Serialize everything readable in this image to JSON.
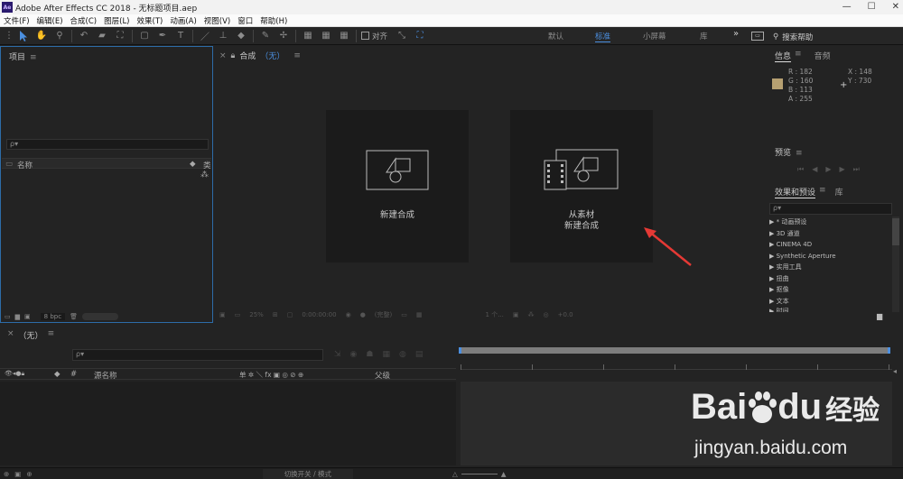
{
  "titlebar": {
    "app_icon": "Ae",
    "title": "Adobe After Effects CC 2018 - 无标题项目.aep",
    "minimize": "—",
    "maximize": "☐",
    "close": "✕"
  },
  "menu": [
    "文件(F)",
    "编辑(E)",
    "合成(C)",
    "图层(L)",
    "效果(T)",
    "动画(A)",
    "视图(V)",
    "窗口",
    "帮助(H)"
  ],
  "toolbar": {
    "align_label": "对齐",
    "expand": "»",
    "search_placeholder": "搜索帮助"
  },
  "workspaces": [
    "默认",
    "标准",
    "小屏幕",
    "库"
  ],
  "project_panel": {
    "tab": "项目",
    "search_placeholder": "ρ▾",
    "col_name": "名称",
    "col_type": "类",
    "bpc": "8 bpc"
  },
  "comp_panel": {
    "tab": "合成",
    "comp_name": "（无）",
    "new_comp": "新建合成",
    "from_footage_line1": "从素材",
    "from_footage_line2": "新建合成",
    "zoom": "25%",
    "timecode": "0:00:00:00",
    "resolution": "(完整)",
    "views": "1 个...",
    "exposure": "+0.0"
  },
  "info_panel": {
    "tab": "信息",
    "tab2": "音频",
    "r": "R : 182",
    "g": "G : 160",
    "b": "B : 113",
    "a": "A : 255",
    "x": "X : 148",
    "y": "Y : 730",
    "swatch_color": "#b6a071"
  },
  "preview_panel": {
    "tab": "预览"
  },
  "effects_panel": {
    "tab": "效果和预设",
    "tab2": "库",
    "search_placeholder": "ρ▾",
    "items": [
      "▶ * 动画预设",
      "▶ 3D 通道",
      "▶ CINEMA 4D",
      "▶ Synthetic Aperture",
      "▶ 实用工具",
      "▶ 扭曲",
      "▶ 抠像",
      "▶ 文本",
      "▶ 时间"
    ]
  },
  "timeline": {
    "tab": "（无）",
    "close": "×",
    "search_placeholder": "ρ▾",
    "col_num": "#",
    "col_source": "源名称",
    "col_switches": "单 ✲ ＼ fx ▣ ◎ ⊘ ⊕",
    "col_parent": "父级"
  },
  "statusbar": {
    "toggle": "切换开关 / 模式"
  },
  "watermark": {
    "brand_a": "Bai",
    "brand_b": "du",
    "suffix": "经验",
    "url": "jingyan.baidu.com"
  },
  "accent": "#4b8fe0"
}
